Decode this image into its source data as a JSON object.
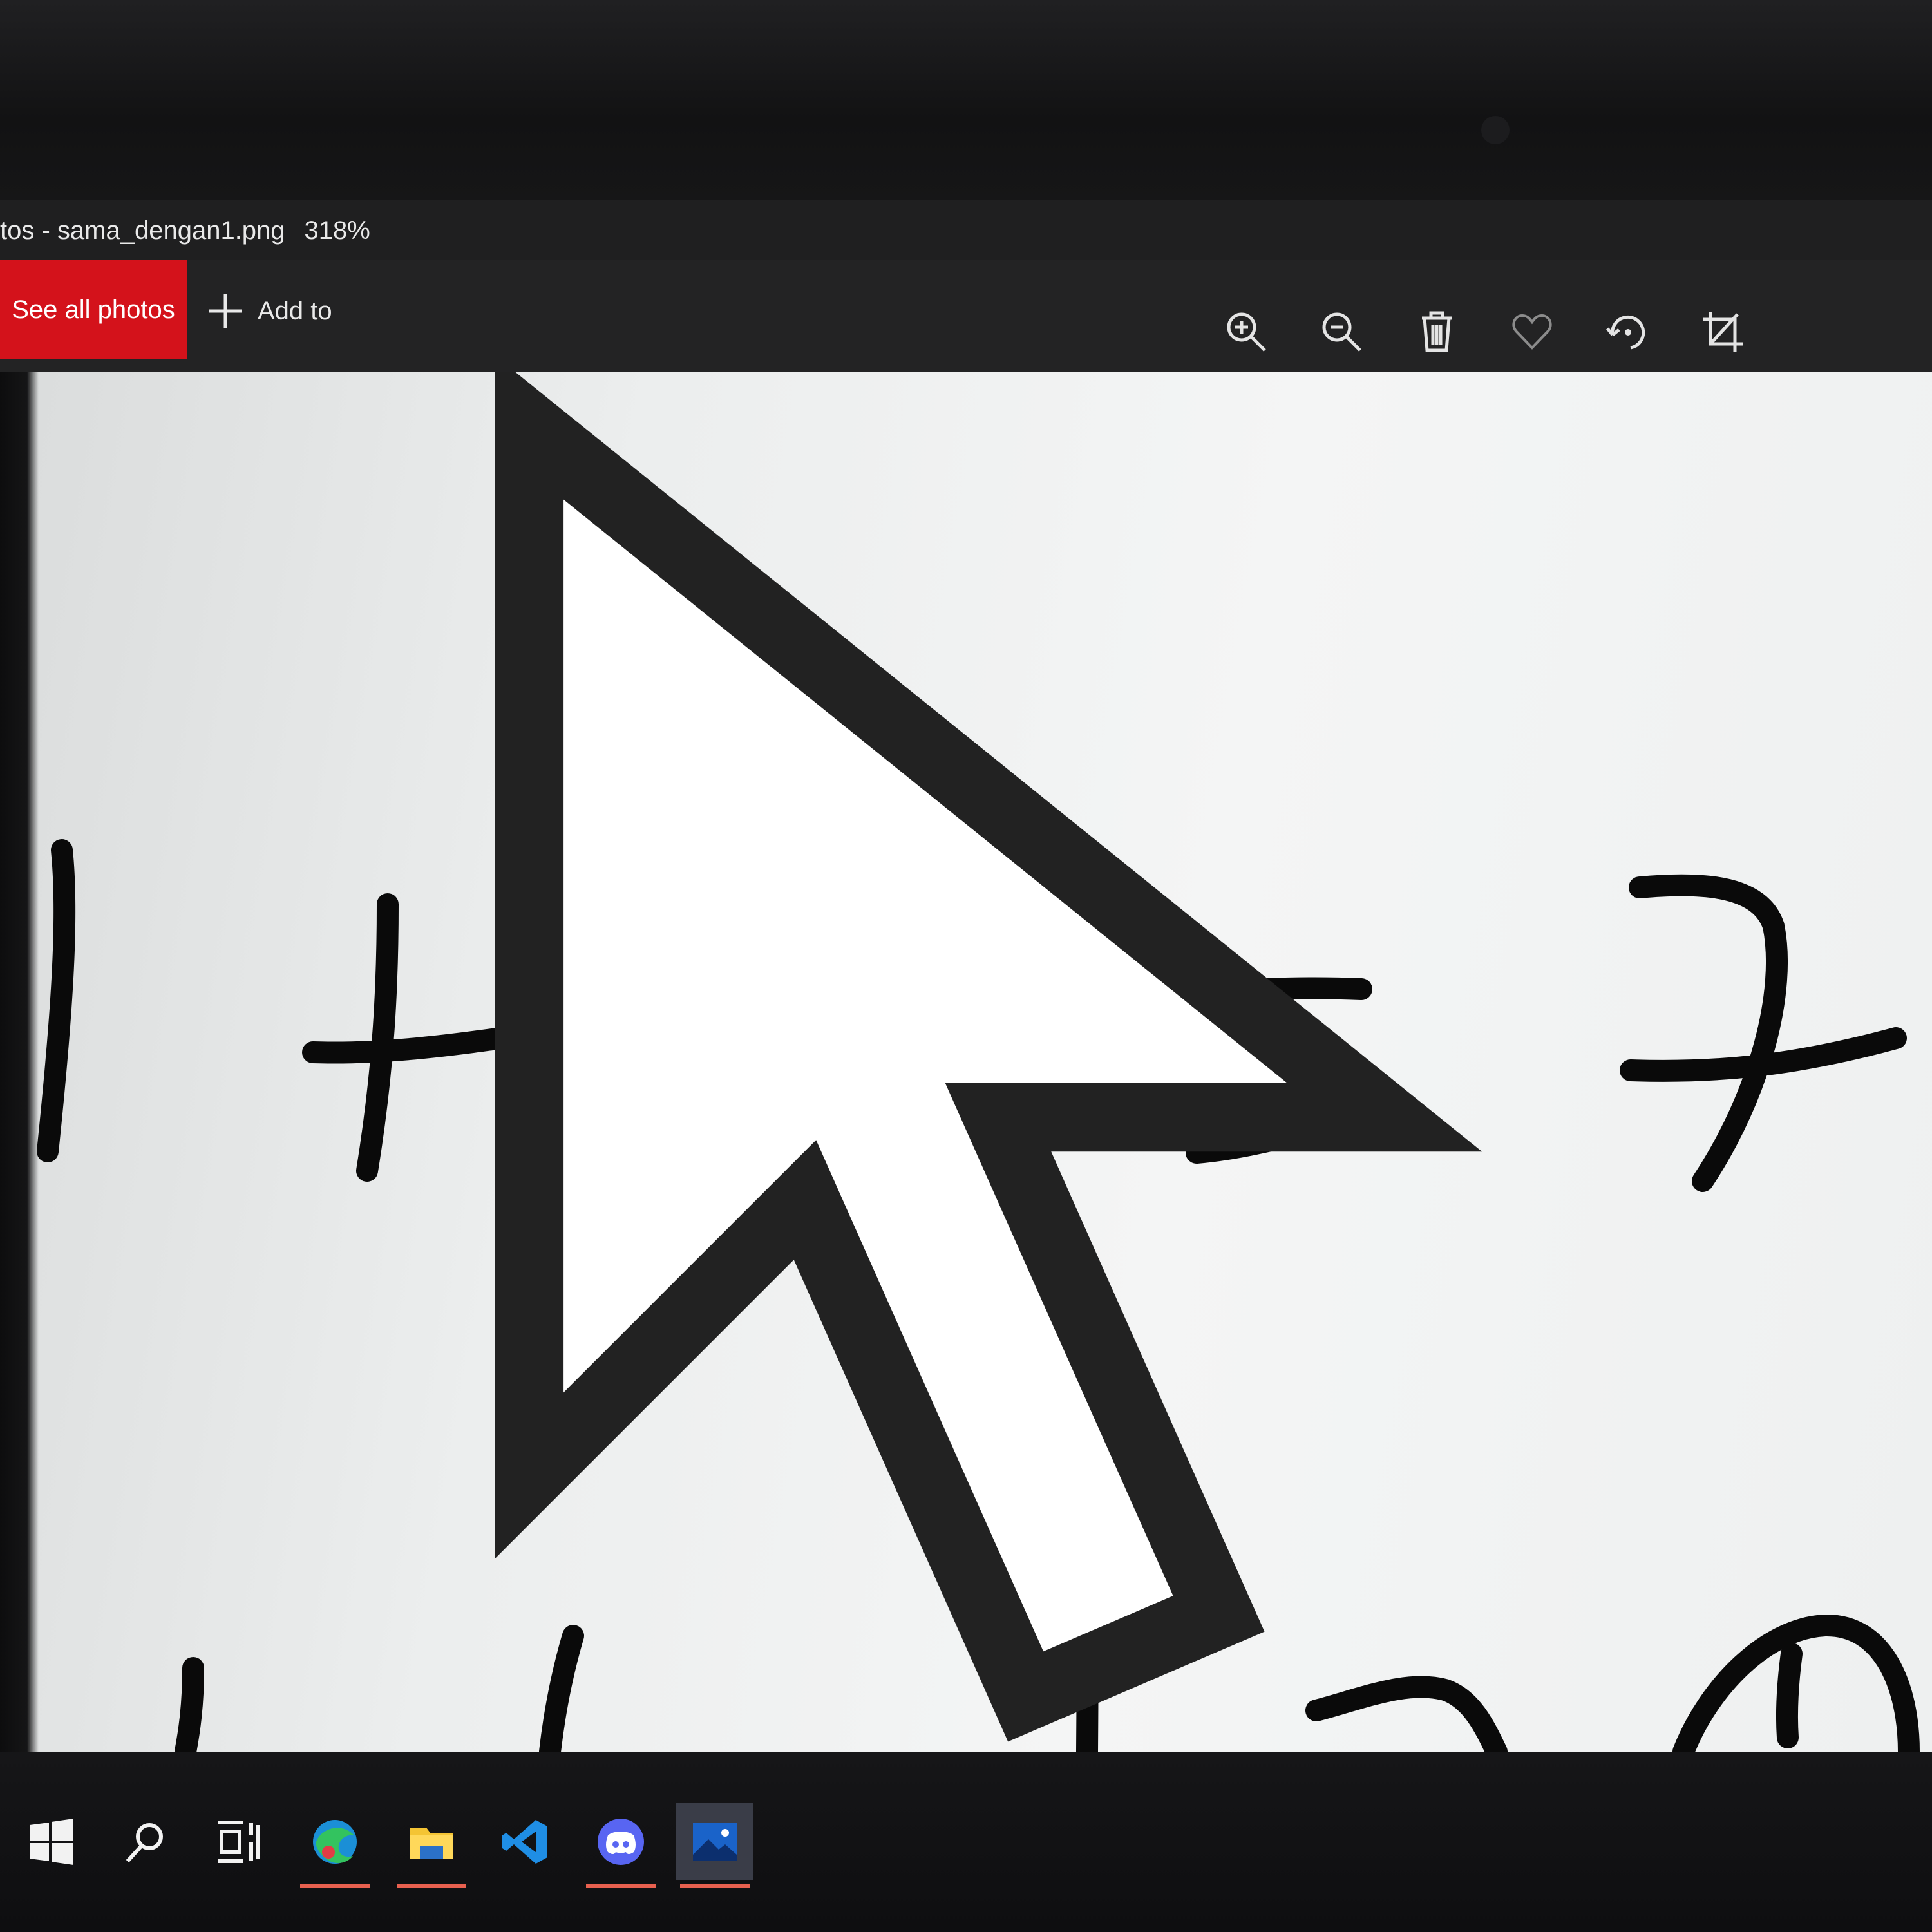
{
  "window": {
    "title": "tos - sama_dengan1.png",
    "zoom": "318%"
  },
  "toolbar": {
    "see_all_label": "See all photos",
    "add_to_label": "Add to",
    "icons": [
      "zoom-in-icon",
      "zoom-out-icon",
      "delete-icon",
      "favorite-icon",
      "rotate-icon",
      "crop-icon"
    ]
  },
  "image": {
    "content": "handwritten equation digits shown as strokes"
  },
  "taskbar": {
    "items": [
      "start",
      "search",
      "task-view",
      "edge",
      "file-explorer",
      "vscode",
      "discord",
      "photos"
    ],
    "active": "photos",
    "accent": "#e8604f"
  },
  "colors": {
    "accent": "#d4121b",
    "titlebar": "#1f1f20"
  }
}
